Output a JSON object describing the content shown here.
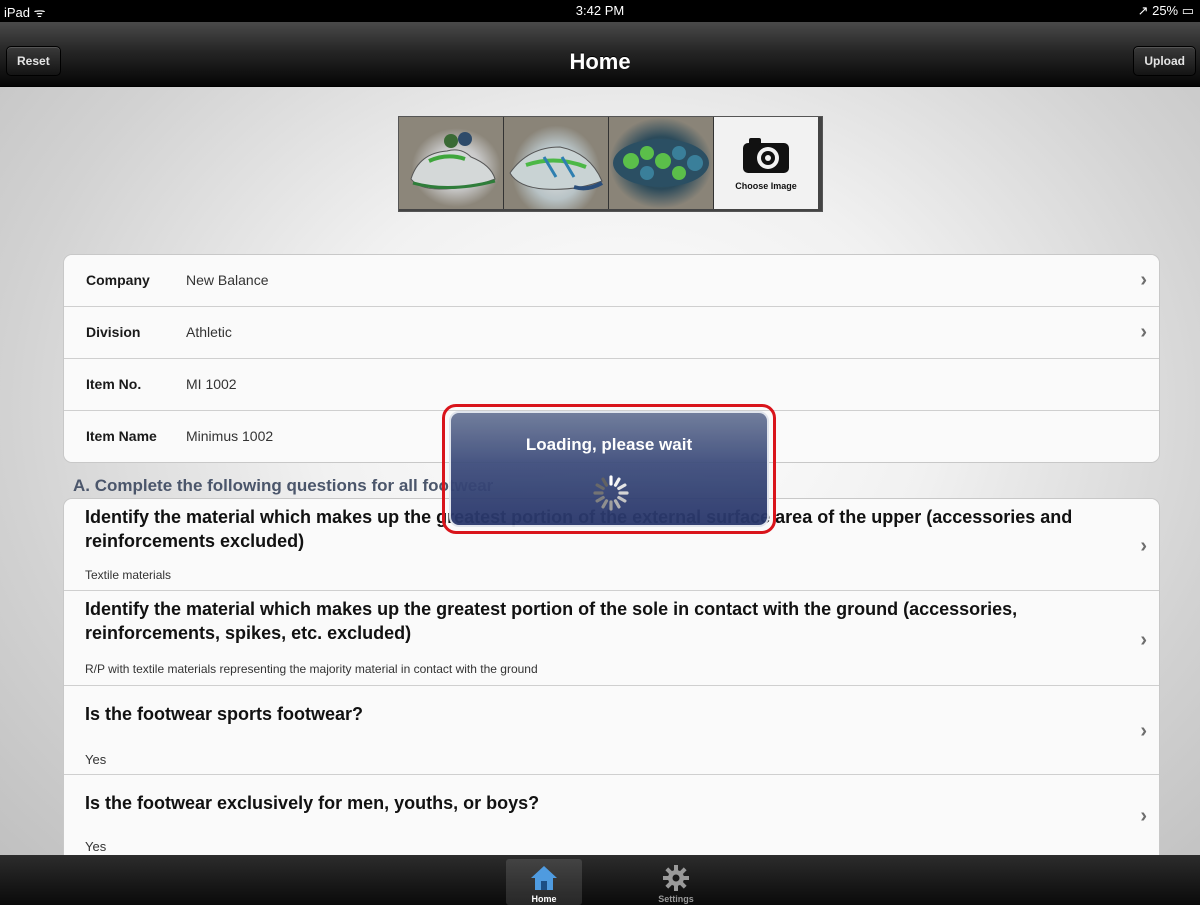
{
  "status_bar": {
    "device": "iPad ᯤ",
    "time": "3:42 PM",
    "battery": "↗ 25% ▭"
  },
  "nav": {
    "reset_label": "Reset",
    "title": "Home",
    "upload_label": "Upload"
  },
  "gallery": {
    "choose_label": "Choose Image",
    "thumbnail_count": 3
  },
  "details": {
    "rows": [
      {
        "key": "Company",
        "value": "New Balance"
      },
      {
        "key": "Division",
        "value": "Athletic"
      },
      {
        "key": "Item No.",
        "value": "MI 1002"
      },
      {
        "key": "Item Name",
        "value": "Minimus 1002"
      }
    ]
  },
  "section_a": {
    "header": "A. Complete the following questions for all footwear",
    "questions": [
      {
        "q": "Identify the material which makes up the greatest portion of the external surface area of the upper (accessories and reinforcements excluded)",
        "a": "Textile materials"
      },
      {
        "q": "Identify the material which makes up the greatest portion of the sole in contact with the ground (accessories, reinforcements, spikes, etc. excluded)",
        "a": "R/P with textile materials representing the majority material in contact with the ground"
      },
      {
        "q": "Is the footwear sports footwear?",
        "a": "Yes"
      },
      {
        "q": "Is the footwear exclusively for men, youths, or boys?",
        "a": "Yes"
      }
    ]
  },
  "loading": {
    "text": "Loading, please wait"
  },
  "tabs": [
    {
      "label": "Home",
      "icon": "home-icon",
      "selected": true
    },
    {
      "label": "Settings",
      "icon": "gear-icon",
      "selected": false
    }
  ],
  "colors": {
    "loading_bg": "#3e4d7c",
    "highlight": "#d9141b",
    "section_header": "#4b566b"
  }
}
